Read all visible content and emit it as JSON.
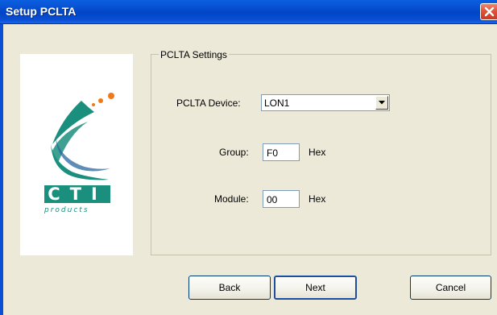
{
  "window": {
    "title": "Setup PCLTA"
  },
  "logo": {
    "brand": "CTI",
    "subtitle": "products"
  },
  "settings": {
    "group_title": "PCLTA Settings",
    "device_label": "PCLTA Device:",
    "device_value": "LON1",
    "group_label": "Group:",
    "group_value": "F0",
    "group_unit": "Hex",
    "module_label": "Module:",
    "module_value": "00",
    "module_unit": "Hex"
  },
  "buttons": {
    "back": "Back",
    "next": "Next",
    "cancel": "Cancel"
  },
  "colors": {
    "titlebar": "#0a4fd4",
    "close": "#e0533a",
    "dialog_bg": "#ece9d8",
    "logo_teal": "#1b8f7e",
    "logo_orange": "#f07a1a"
  },
  "icons": {
    "close": "close-icon",
    "dropdown": "chevron-down-icon"
  }
}
